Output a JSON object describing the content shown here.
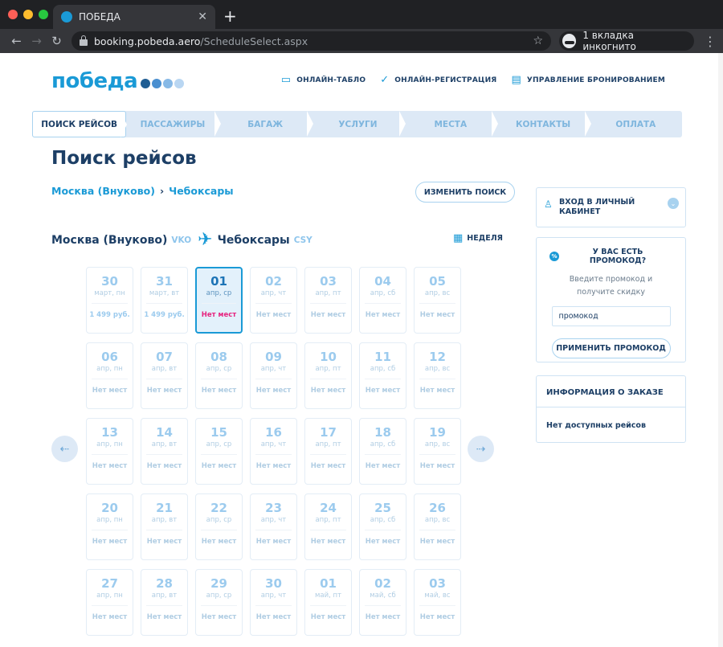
{
  "browser": {
    "tab_title": "ПОБЕДА",
    "url_host": "booking.pobeda.aero",
    "url_path": "/ScheduleSelect.aspx",
    "incognito_label": "1 вкладка инкогнито",
    "new_tab": "+",
    "close": "✕",
    "back": "←",
    "forward": "→",
    "reload": "↻",
    "star": "☆",
    "menu": "⋮"
  },
  "header": {
    "logo": "победа",
    "links": [
      {
        "icon": "monitor-icon",
        "glyph": "▭",
        "label": "ОНЛАЙН-ТАБЛО"
      },
      {
        "icon": "check-circle-icon",
        "glyph": "✓",
        "label": "ОНЛАЙН-РЕГИСТРАЦИЯ"
      },
      {
        "icon": "card-icon",
        "glyph": "▤",
        "label": "УПРАВЛЕНИЕ БРОНИРОВАНИЕМ"
      }
    ]
  },
  "steps": [
    "ПОИСК РЕЙСОВ",
    "ПАССАЖИРЫ",
    "БАГАЖ",
    "УСЛУГИ",
    "МЕСТА",
    "КОНТАКТЫ",
    "ОПЛАТА"
  ],
  "main": {
    "title": "Поиск рейсов",
    "route_from": "Москва (Внуково)",
    "route_sep": "›",
    "route_to": "Чебоксары",
    "change_search": "ИЗМЕНИТЬ ПОИСК",
    "leg": {
      "from_city": "Москва (Внуково)",
      "from_code": "VKO",
      "plane": "✈",
      "to_city": "Чебоксары",
      "to_code": "CSY"
    },
    "week_label": "НЕДЕЛЯ",
    "week_icon": "▦",
    "prev_arrow": "⇠",
    "next_arrow": "⇢"
  },
  "calendar": [
    {
      "num": "30",
      "wd": "март, пн",
      "price": "1 499 руб.",
      "state": "price"
    },
    {
      "num": "31",
      "wd": "март, вт",
      "price": "1 499 руб.",
      "state": "price"
    },
    {
      "num": "01",
      "wd": "апр, ср",
      "price": "Нет мест",
      "state": "selected"
    },
    {
      "num": "02",
      "wd": "апр, чт",
      "price": "Нет мест",
      "state": "none"
    },
    {
      "num": "03",
      "wd": "апр, пт",
      "price": "Нет мест",
      "state": "none"
    },
    {
      "num": "04",
      "wd": "апр, сб",
      "price": "Нет мест",
      "state": "none"
    },
    {
      "num": "05",
      "wd": "апр, вс",
      "price": "Нет мест",
      "state": "none"
    },
    {
      "num": "06",
      "wd": "апр, пн",
      "price": "Нет мест",
      "state": "none"
    },
    {
      "num": "07",
      "wd": "апр, вт",
      "price": "Нет мест",
      "state": "none"
    },
    {
      "num": "08",
      "wd": "апр, ср",
      "price": "Нет мест",
      "state": "none"
    },
    {
      "num": "09",
      "wd": "апр, чт",
      "price": "Нет мест",
      "state": "none"
    },
    {
      "num": "10",
      "wd": "апр, пт",
      "price": "Нет мест",
      "state": "none"
    },
    {
      "num": "11",
      "wd": "апр, сб",
      "price": "Нет мест",
      "state": "none"
    },
    {
      "num": "12",
      "wd": "апр, вс",
      "price": "Нет мест",
      "state": "none"
    },
    {
      "num": "13",
      "wd": "апр, пн",
      "price": "Нет мест",
      "state": "none"
    },
    {
      "num": "14",
      "wd": "апр, вт",
      "price": "Нет мест",
      "state": "none"
    },
    {
      "num": "15",
      "wd": "апр, ср",
      "price": "Нет мест",
      "state": "none"
    },
    {
      "num": "16",
      "wd": "апр, чт",
      "price": "Нет мест",
      "state": "none"
    },
    {
      "num": "17",
      "wd": "апр, пт",
      "price": "Нет мест",
      "state": "none"
    },
    {
      "num": "18",
      "wd": "апр, сб",
      "price": "Нет мест",
      "state": "none"
    },
    {
      "num": "19",
      "wd": "апр, вс",
      "price": "Нет мест",
      "state": "none"
    },
    {
      "num": "20",
      "wd": "апр, пн",
      "price": "Нет мест",
      "state": "none"
    },
    {
      "num": "21",
      "wd": "апр, вт",
      "price": "Нет мест",
      "state": "none"
    },
    {
      "num": "22",
      "wd": "апр, ср",
      "price": "Нет мест",
      "state": "none"
    },
    {
      "num": "23",
      "wd": "апр, чт",
      "price": "Нет мест",
      "state": "none"
    },
    {
      "num": "24",
      "wd": "апр, пт",
      "price": "Нет мест",
      "state": "none"
    },
    {
      "num": "25",
      "wd": "апр, сб",
      "price": "Нет мест",
      "state": "none"
    },
    {
      "num": "26",
      "wd": "апр, вс",
      "price": "Нет мест",
      "state": "none"
    },
    {
      "num": "27",
      "wd": "апр, пн",
      "price": "Нет мест",
      "state": "none"
    },
    {
      "num": "28",
      "wd": "апр, вт",
      "price": "Нет мест",
      "state": "none"
    },
    {
      "num": "29",
      "wd": "апр, ср",
      "price": "Нет мест",
      "state": "none"
    },
    {
      "num": "30",
      "wd": "апр, чт",
      "price": "Нет мест",
      "state": "none"
    },
    {
      "num": "01",
      "wd": "май, пт",
      "price": "Нет мест",
      "state": "none"
    },
    {
      "num": "02",
      "wd": "май, сб",
      "price": "Нет мест",
      "state": "none"
    },
    {
      "num": "03",
      "wd": "май, вс",
      "price": "Нет мест",
      "state": "none"
    }
  ],
  "sidebar": {
    "login_label": "ВХОД В ЛИЧНЫЙ КАБИНЕТ",
    "user_glyph": "♙",
    "chevron": "⌄",
    "promo_title": "У ВАС ЕСТЬ ПРОМОКОД?",
    "promo_glyph": "%",
    "promo_hint": "Введите промокод и получите скидку",
    "promo_value": "промокод",
    "promo_apply": "ПРИМЕНИТЬ ПРОМОКОД",
    "order_title": "ИНФОРМАЦИЯ О ЗАКАЗЕ",
    "order_empty": "Нет доступных рейсов"
  },
  "colors": {
    "brand": "#1a9ad6",
    "dark": "#1d3f66",
    "no_seats_selected": "#e6237e"
  }
}
